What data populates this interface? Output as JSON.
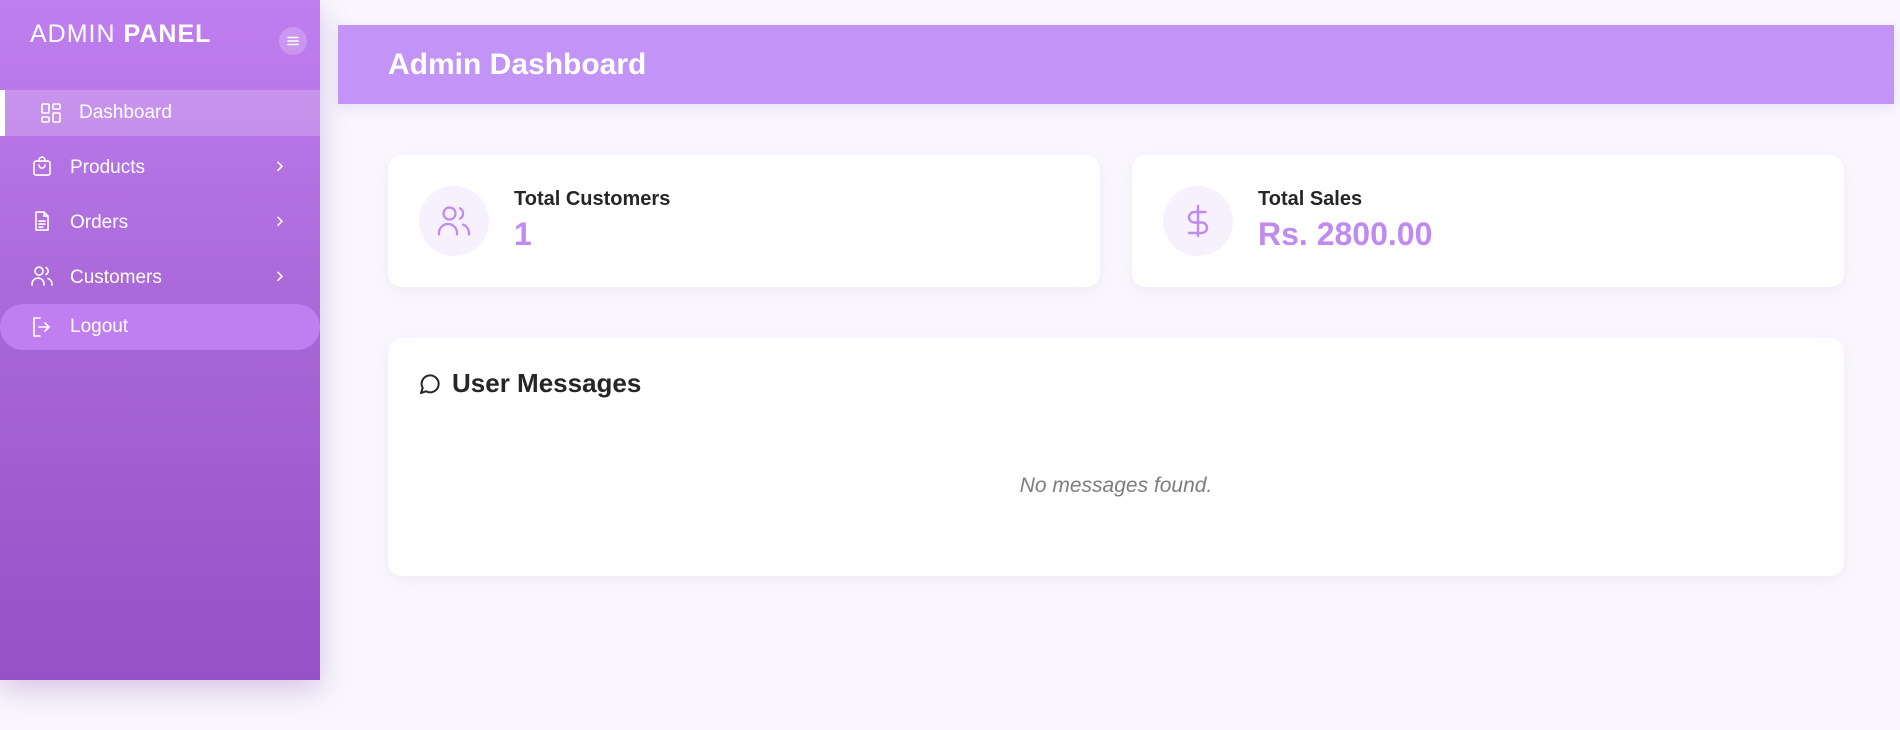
{
  "sidebar": {
    "brand_light": "ADMIN",
    "brand_bold": "PANEL",
    "toggle_icon": "menu-icon",
    "items": [
      {
        "label": "Dashboard",
        "icon": "dashboard-grid-icon",
        "active": true
      },
      {
        "label": "Products",
        "icon": "shopping-bag-icon",
        "has_submenu": true
      },
      {
        "label": "Orders",
        "icon": "document-icon",
        "has_submenu": true
      },
      {
        "label": "Customers",
        "icon": "users-icon",
        "has_submenu": true
      },
      {
        "label": "Logout",
        "icon": "logout-icon"
      }
    ]
  },
  "header": {
    "title": "Admin Dashboard"
  },
  "stats": [
    {
      "label": "Total Customers",
      "value": "1",
      "icon": "users-icon"
    },
    {
      "label": "Total Sales",
      "value": "Rs. 2800.00",
      "icon": "dollar-icon"
    }
  ],
  "messages": {
    "title": "User Messages",
    "icon": "message-circle-icon",
    "empty_text": "No messages found."
  },
  "colors": {
    "accent": "#c394f8",
    "sidebar_top": "#c07ff0",
    "sidebar_bottom": "#9551c6",
    "value_text": "#c08bf0",
    "page_bg": "#f9f7fd"
  }
}
